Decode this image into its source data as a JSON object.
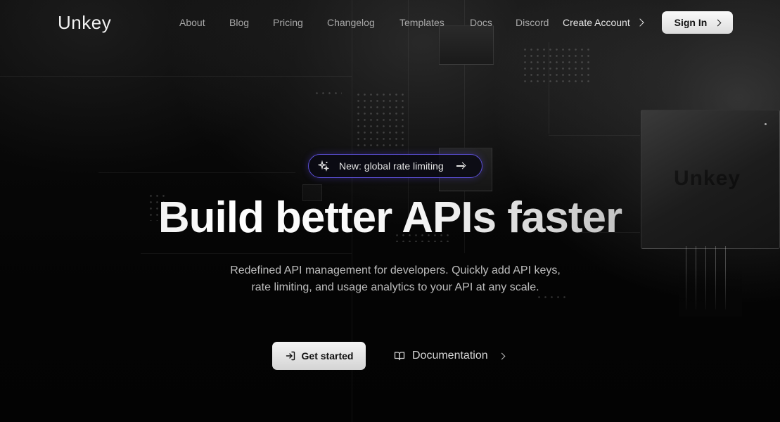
{
  "brand": {
    "name": "Unkey",
    "chip_mark": "Unkey"
  },
  "nav": {
    "links": [
      "About",
      "Blog",
      "Pricing",
      "Changelog",
      "Templates",
      "Docs",
      "Discord"
    ],
    "create_account": "Create Account",
    "sign_in": "Sign In"
  },
  "hero": {
    "badge": "New: global rate limiting",
    "title": "Build better APIs faster",
    "subtitle": "Redefined API management for developers. Quickly add API keys, rate limiting, and usage analytics to your API at any scale.",
    "primary_cta": "Get started",
    "secondary_cta": "Documentation"
  },
  "icons": {
    "sparkle": "sparkle-icon",
    "arrow": "arrow-right-icon",
    "login": "login-icon",
    "book": "book-icon",
    "chevron": "chevron-right-icon"
  },
  "colors": {
    "accent_border": "#5b4fd6",
    "background": "#060606",
    "button_bg": "#eeeeee"
  }
}
